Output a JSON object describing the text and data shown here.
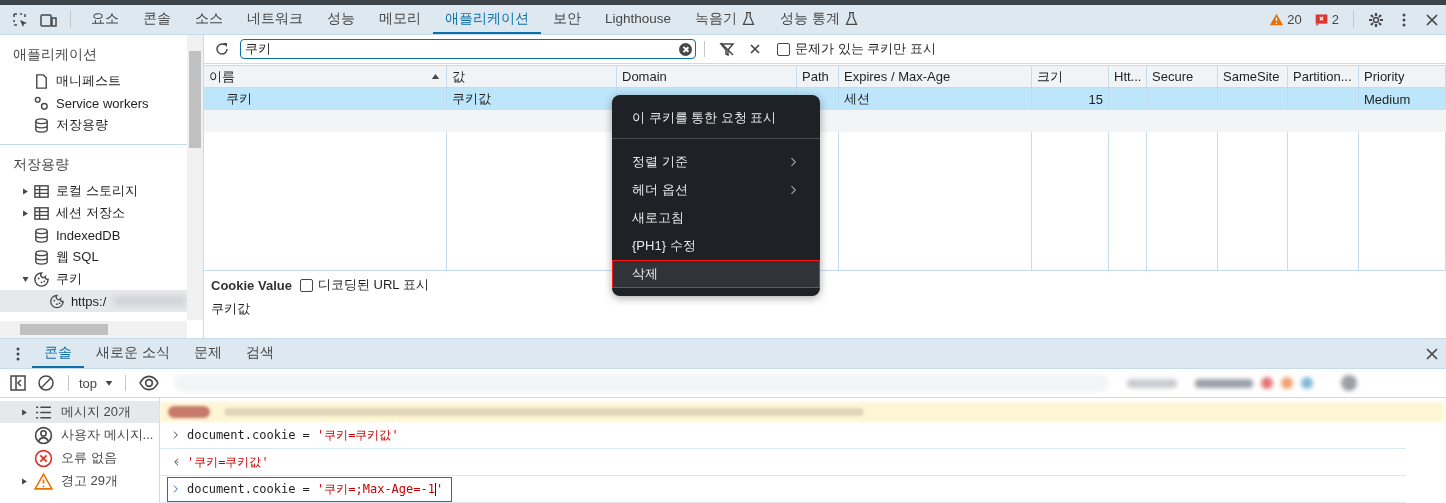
{
  "main_tabs": [
    {
      "label": "요소",
      "selected": false
    },
    {
      "label": "콘솔",
      "selected": false
    },
    {
      "label": "소스",
      "selected": false
    },
    {
      "label": "네트워크",
      "selected": false
    },
    {
      "label": "성능",
      "selected": false
    },
    {
      "label": "메모리",
      "selected": false
    },
    {
      "label": "애플리케이션",
      "selected": true
    },
    {
      "label": "보안",
      "selected": false
    },
    {
      "label": "Lighthouse",
      "selected": false
    },
    {
      "label": "녹음기",
      "selected": false,
      "experimental": true
    },
    {
      "label": "성능 통계",
      "selected": false,
      "experimental": true
    }
  ],
  "issue_counts": {
    "warnings": "20",
    "errors": "2"
  },
  "sidebar": {
    "sections": [
      {
        "title": "애플리케이션",
        "items": [
          {
            "label": "매니페스트",
            "kind": "file",
            "selected": false
          },
          {
            "label": "Service workers",
            "kind": "gears",
            "selected": false
          },
          {
            "label": "저장용량",
            "kind": "database",
            "selected": false
          }
        ]
      },
      {
        "title": "저장용량",
        "items": [
          {
            "label": "로컬 스토리지",
            "kind": "table",
            "expanded": false,
            "selected": false
          },
          {
            "label": "세션 저장소",
            "kind": "table",
            "expanded": false,
            "selected": false
          },
          {
            "label": "IndexedDB",
            "kind": "database",
            "selected": false
          },
          {
            "label": "웹 SQL",
            "kind": "database",
            "selected": false
          },
          {
            "label": "쿠키",
            "kind": "cookie",
            "expanded": true,
            "selected": false,
            "children": [
              {
                "label": "https:/",
                "kind": "cookie",
                "selected": true,
                "redacted": true
              }
            ]
          }
        ]
      }
    ]
  },
  "cookie_toolbar": {
    "filter_value": "쿠키",
    "only_issues": {
      "label": "문제가 있는 쿠키만 표시",
      "checked": false
    }
  },
  "table": {
    "columns": [
      {
        "label": "이름",
        "sort_ascending": true
      },
      {
        "label": "값"
      },
      {
        "label": "Domain"
      },
      {
        "label": "Path"
      },
      {
        "label": "Expires / Max-Age"
      },
      {
        "label": "크기"
      },
      {
        "label": "Htt..."
      },
      {
        "label": "Secure"
      },
      {
        "label": "SameSite"
      },
      {
        "label": "Partition..."
      },
      {
        "label": "Priority"
      }
    ],
    "rows": [
      {
        "selected": true,
        "cells": [
          "쿠키",
          "쿠키값",
          null,
          null,
          "세션",
          "15",
          null,
          null,
          null,
          null,
          "Medium"
        ]
      }
    ]
  },
  "cookie_value": {
    "title": "Cookie Value",
    "decoded": {
      "label": "디코딩된 URL 표시",
      "checked": false
    },
    "value": "쿠키값"
  },
  "context_menu": {
    "items": [
      {
        "kind": "item",
        "label": "이 쿠키를 통한 요청 표시",
        "selected": false,
        "annotated": false
      },
      {
        "kind": "separator"
      },
      {
        "kind": "submenu",
        "label": "정렬 기준",
        "selected": false,
        "annotated": false
      },
      {
        "kind": "submenu",
        "label": "헤더 옵션",
        "selected": false,
        "annotated": false
      },
      {
        "kind": "item",
        "label": "새로고침",
        "selected": false,
        "annotated": false
      },
      {
        "kind": "item",
        "label": "{PH1} 수정",
        "selected": false,
        "annotated": false
      },
      {
        "kind": "item",
        "label": "삭제",
        "selected": true,
        "annotated": true
      }
    ]
  },
  "drawer_tabs": [
    {
      "label": "콘솔",
      "selected": true
    },
    {
      "label": "새로운 소식",
      "selected": false
    },
    {
      "label": "문제",
      "selected": false
    },
    {
      "label": "검색",
      "selected": false
    }
  ],
  "console_toolbar": {
    "context": "top",
    "redacted": true
  },
  "console_sidebar": [
    {
      "label": "메시지 20개",
      "kind": "list",
      "expanded": false,
      "selected": true
    },
    {
      "label": "사용자 메시지...",
      "kind": "user",
      "selected": false
    },
    {
      "label": "오류 없음",
      "kind": "error",
      "selected": false
    },
    {
      "label": "경고 29개",
      "kind": "warning",
      "expanded": false,
      "selected": false
    }
  ],
  "console_lines": [
    {
      "kind": "redacted"
    },
    {
      "kind": "input",
      "code": "document.cookie = ",
      "string": "'쿠키=쿠키값'",
      "annotated": false
    },
    {
      "kind": "result",
      "string": "'쿠키=쿠키값'",
      "annotated": false
    },
    {
      "kind": "input",
      "code": "document.cookie = ",
      "string": "'쿠키=;Max-Age=-1",
      "after_caret": "'",
      "annotated": true
    }
  ]
}
